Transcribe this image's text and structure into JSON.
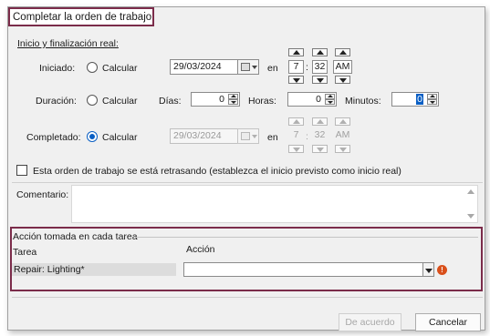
{
  "window": {
    "title": "Completar la orden de trabajo"
  },
  "schedule": {
    "section_title": "Inicio y finalización real:",
    "started": {
      "label": "Iniciado:",
      "radio_label": "Calcular",
      "radio_checked": false,
      "date": "29/03/2024",
      "en_label": "en",
      "hour": "7",
      "colon": ":",
      "minute": "32",
      "ampm": "AM"
    },
    "duration": {
      "label": "Duración:",
      "radio_label": "Calcular",
      "radio_checked": false,
      "days_label": "Días:",
      "days_value": "0",
      "hours_label": "Horas:",
      "hours_value": "0",
      "minutes_label": "Minutos:",
      "minutes_value": "0"
    },
    "completed": {
      "label": "Completado:",
      "radio_label": "Calcular",
      "radio_checked": true,
      "date": "29/03/2024",
      "en_label": "en",
      "hour": "7",
      "colon": ":",
      "minute": "32",
      "ampm": "AM"
    }
  },
  "delayed_checkbox": {
    "label": "Esta orden de trabajo se está retrasando (establezca el inicio previsto como inicio real)",
    "checked": false
  },
  "comment": {
    "label": "Comentario:",
    "value": ""
  },
  "task_actions": {
    "group_title": "Acción tomada en cada tarea",
    "task_header": "Tarea",
    "action_header": "Acción",
    "rows": [
      {
        "task": "Repair: Lighting*",
        "action": "",
        "error_icon": "!"
      }
    ]
  },
  "buttons": {
    "ok": "De acuerdo",
    "cancel": "Cancelar"
  },
  "colors": {
    "highlight_border": "#7b2c4a",
    "radio_accent": "#0a5fc4",
    "error_icon": "#d94f1a"
  }
}
